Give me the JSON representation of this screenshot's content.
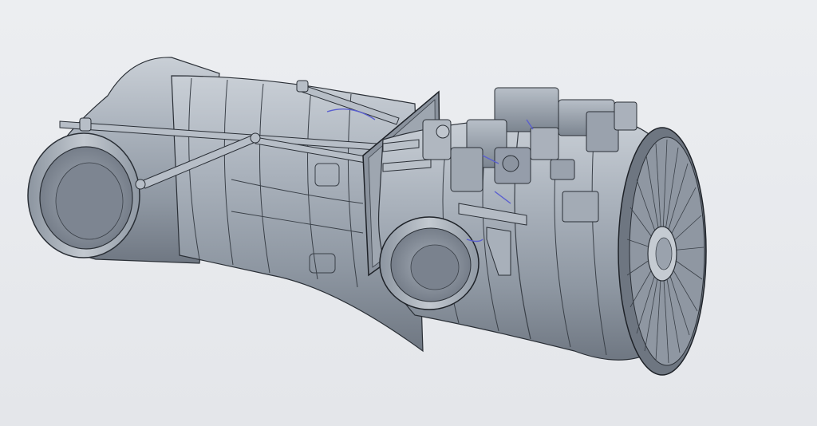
{
  "scene": {
    "subject": "jet-engine-cad-model",
    "background_color": "#e6e8ec",
    "body_color": "#9aa3ae",
    "highlight_color": "#c9cfd6",
    "edge_color": "#2a2f36",
    "accent_color": "#5a5fd0"
  }
}
